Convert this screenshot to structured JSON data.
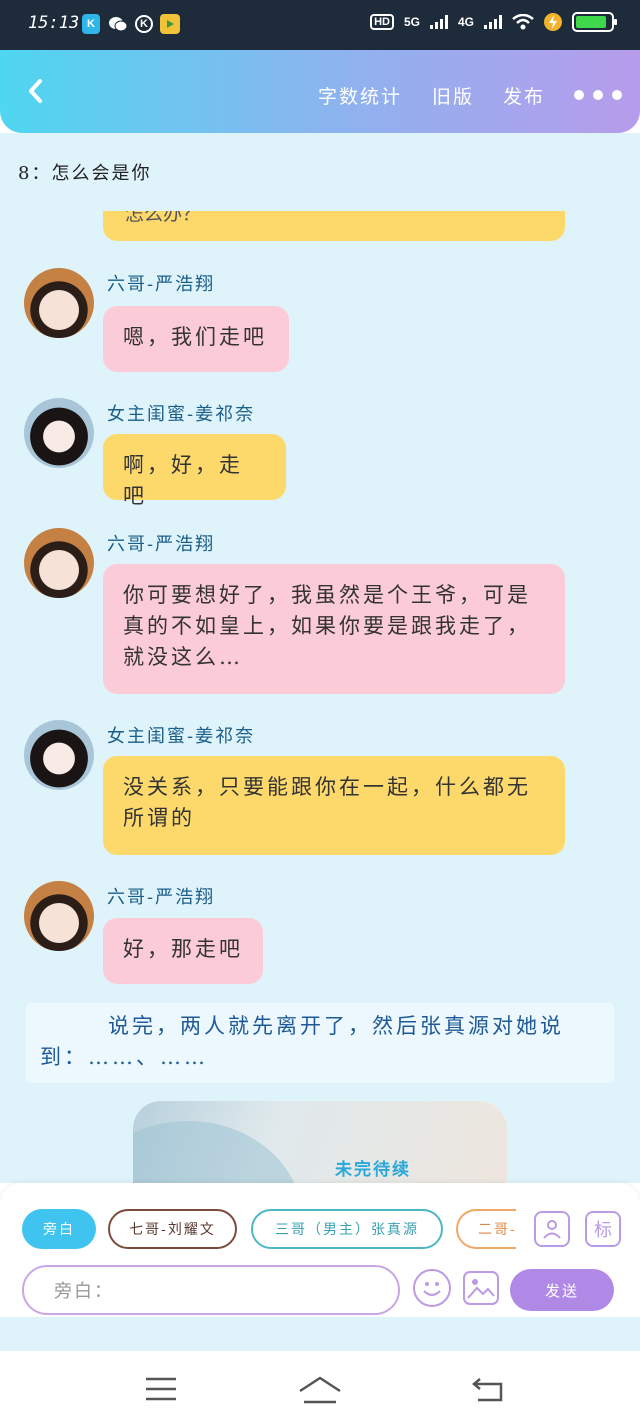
{
  "status_bar": {
    "time": "15:13",
    "network_1": "5G",
    "network_2": "4G",
    "hd_label": "HD"
  },
  "header": {
    "nav_items": [
      "字数统计",
      "旧版",
      "发布"
    ]
  },
  "chapter_title": "8：怎么会是你",
  "clipped_bubble_text": "怎么办？",
  "messages": [
    {
      "sender": "六哥-严浩翔",
      "text": "嗯，我们走吧",
      "color": "pink",
      "avatar": "boy"
    },
    {
      "sender": "女主闺蜜-姜祁奈",
      "text": "啊，好，走吧",
      "color": "yellow",
      "avatar": "girl"
    },
    {
      "sender": "六哥-严浩翔",
      "text": "你可要想好了，我虽然是个王爷，可是真的不如皇上，如果你要是跟我走了，就没这么…",
      "color": "pink",
      "avatar": "boy"
    },
    {
      "sender": "女主闺蜜-姜祁奈",
      "text": "没关系，只要能跟你在一起，什么都无所谓的",
      "color": "yellow",
      "avatar": "girl"
    },
    {
      "sender": "六哥-严浩翔",
      "text": "好，那走吧",
      "color": "pink",
      "avatar": "boy"
    }
  ],
  "narration": "说完，两人就先离开了，然后张真源对她说到：……、……",
  "image_card": {
    "caption": "未完待续"
  },
  "composer": {
    "characters": [
      "旁白",
      "七哥-刘耀文",
      "三哥（男主）张真源",
      "二哥-"
    ],
    "input_placeholder": "旁白：",
    "send_label": "发送",
    "mark_label": "标"
  },
  "colors": {
    "header_start": "#4fd6f0",
    "header_end": "#b79cec",
    "pink_bubble": "#fccbd8",
    "yellow_bubble": "#fdd96c",
    "content_bg": "#dff3fb",
    "send_button": "#b089e6"
  }
}
